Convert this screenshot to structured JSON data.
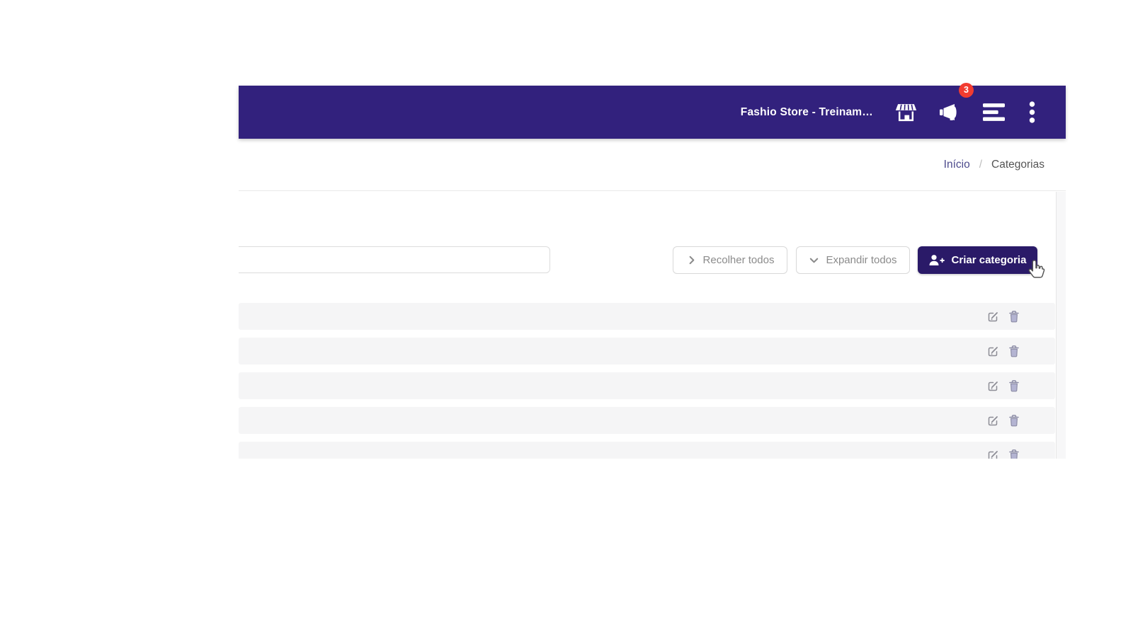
{
  "topbar": {
    "store_name": "Fashio Store - Treinam…",
    "notification_badge": "3",
    "icons": {
      "store": "storefront-icon",
      "announcements": "megaphone-icon",
      "list": "stacked-list-icon",
      "more": "kebab-menu-icon"
    }
  },
  "breadcrumb": {
    "home": "Início",
    "separator": "/",
    "current": "Categorias"
  },
  "toolbar": {
    "search_value": "",
    "search_placeholder": "",
    "collapse_all": "Recolher todos",
    "expand_all": "Expandir todos",
    "create_category": "Criar categoria",
    "icons": {
      "collapse": "chevron-right-icon",
      "expand": "chevron-down-icon",
      "create": "user-plus-icon"
    }
  },
  "category_list": {
    "row_count": 5,
    "row_icons": [
      "edit-icon",
      "trash-icon"
    ]
  },
  "cursor": "pointer-hand-cursor",
  "colors": {
    "topbar_bg": "#32217d",
    "primary_button_bg": "#2a1a68",
    "badge_bg": "#f23c30",
    "row_bg": "#f5f5f6",
    "breadcrumb_link": "#4c4a8c",
    "divider": "#e9e9e9",
    "button_border": "#d8d8d8",
    "muted_text": "#8b8b8b"
  }
}
